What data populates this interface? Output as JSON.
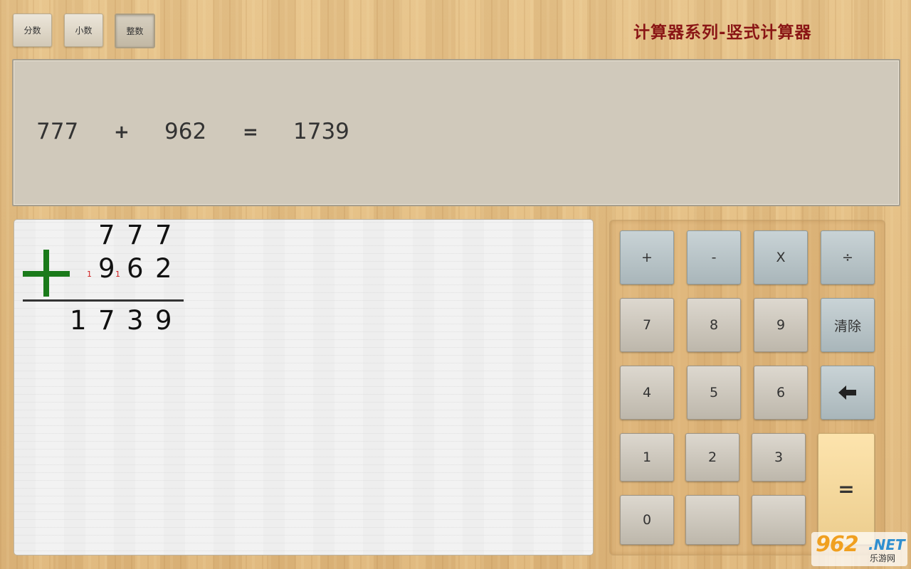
{
  "mode_buttons": {
    "fraction": "分数",
    "decimal": "小数",
    "integer": "整数"
  },
  "app_title": "计算器系列-竖式计算器",
  "display": {
    "operand1": "777",
    "operator": "+",
    "operand2": "962",
    "equals": "=",
    "result": "1739"
  },
  "vertical": {
    "top_digits": [
      "7",
      "7",
      "7"
    ],
    "mid_digits": [
      "9",
      "6",
      "2"
    ],
    "carries": [
      "1",
      "1"
    ],
    "result_digits": [
      "1",
      "7",
      "3",
      "9"
    ],
    "operator_color": "#1a7a1a",
    "carry_color": "#d01c1c"
  },
  "keypad": {
    "plus": "+",
    "minus": "-",
    "multiply": "X",
    "divide": "÷",
    "seven": "7",
    "eight": "8",
    "nine": "9",
    "clear": "清除",
    "four": "4",
    "five": "5",
    "six": "6",
    "backspace_icon": "arrow-left-icon",
    "one": "1",
    "two": "2",
    "three": "3",
    "equals": "=",
    "zero": "0",
    "blank1": "",
    "blank2": ""
  },
  "watermark": {
    "big": "962",
    "net": ".NET",
    "small": "乐游网"
  }
}
